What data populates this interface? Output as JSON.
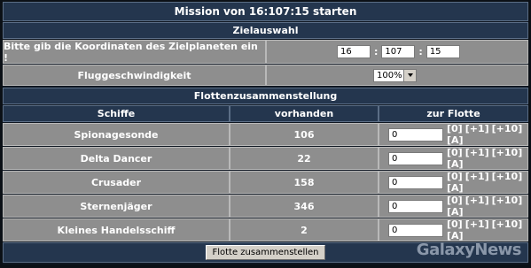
{
  "title": "Mission von 16:107:15 starten",
  "zielauswahl": {
    "heading": "Zielauswahl",
    "coords_label": "Bitte gib die Koordinaten des Zielplaneten ein !",
    "coord_galaxy": "16",
    "coord_system": "107",
    "coord_planet": "15",
    "separator": ":",
    "speed_label": "Fluggeschwindigkeit",
    "speed_value": "100%"
  },
  "flotte": {
    "heading": "Flottenzusammenstellung",
    "columns": [
      "Schiffe",
      "vorhanden",
      "zur Flotte"
    ],
    "ships": [
      {
        "name": "Spionagesonde",
        "available": "106",
        "amount": "0"
      },
      {
        "name": "Delta Dancer",
        "available": "22",
        "amount": "0"
      },
      {
        "name": "Crusader",
        "available": "158",
        "amount": "0"
      },
      {
        "name": "Sternenjäger",
        "available": "346",
        "amount": "0"
      },
      {
        "name": "Kleines Handelsschiff",
        "available": "2",
        "amount": "0"
      }
    ],
    "links": [
      "[0]",
      "[+1]",
      "[+10]",
      "[A]"
    ],
    "submit_label": "Flotte zusammenstellen"
  },
  "watermark": "GalaxyNews"
}
